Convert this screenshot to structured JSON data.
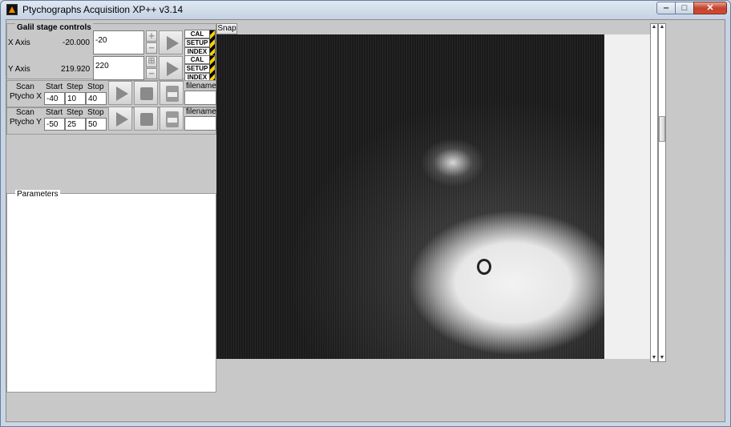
{
  "window": {
    "title": "Ptychographs Acquisition XP++ v3.14",
    "controls": {
      "minimize": "‒",
      "maximize": "□",
      "close": "✕"
    }
  },
  "galil": {
    "title": "Galil stage controls",
    "x_axis": {
      "label": "X Axis",
      "readout": "-20.000",
      "value": "-20"
    },
    "y_axis": {
      "label": "Y Axis",
      "readout": "219.920",
      "value": "220"
    },
    "buttons": {
      "cal": "CAL",
      "setup": "SETUP",
      "index": "INDEX",
      "plus": "+",
      "minus": "−",
      "grid": "⊞"
    }
  },
  "scans": {
    "x": {
      "label_line1": "Scan",
      "label_line2": "Ptycho X",
      "start_label": "Start",
      "step_label": "Step",
      "stop_label": "Stop",
      "start": "-40",
      "step": "10",
      "stop": "40",
      "filename_label": "filename",
      "filename": ""
    },
    "y": {
      "label_line1": "Scan",
      "label_line2": "Ptycho Y",
      "start_label": "Start",
      "step_label": "Step",
      "stop_label": "Stop",
      "start": "-50",
      "step": "25",
      "stop": "50",
      "filename_label": "filename",
      "filename": ""
    }
  },
  "parameters": {
    "title": "Parameters"
  },
  "snap": {
    "label": "Snap"
  },
  "scrollbars": {
    "up": "▲",
    "down": "▼"
  },
  "colors": {
    "hazard_yellow": "#f7d000",
    "panel_gray": "#c8c8c8",
    "title_gradient": "#c5d3e4",
    "close_red": "#c4422c"
  },
  "icons": [
    "app-icon",
    "play-icon",
    "stop-icon",
    "save-icon",
    "plus-icon",
    "minus-icon",
    "grid-icon",
    "hazard-stripe-icon"
  ]
}
